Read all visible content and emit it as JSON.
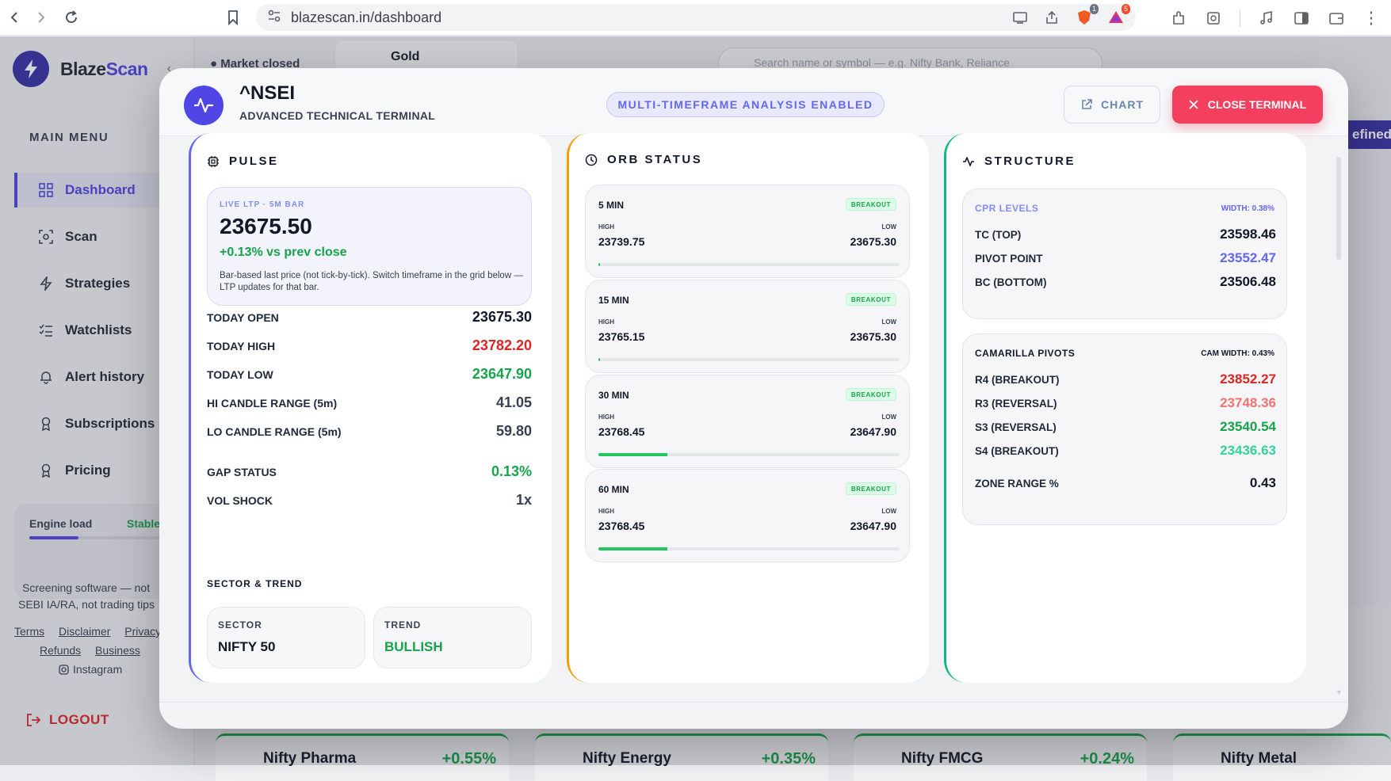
{
  "browser": {
    "url": "blazescan.in/dashboard",
    "ext_badge_1": "1",
    "ext_badge_2": "5"
  },
  "background": {
    "brand_left": "Blaze",
    "brand_right": "Scan",
    "market_status": "● Market closed",
    "gold_label": "Gold",
    "search_placeholder": "Search name or symbol — e.g. Nifty Bank, Reliance",
    "defined_label": "efined",
    "menu_heading": "MAIN MENU",
    "menu_items": [
      "Dashboard",
      "Scan",
      "Strategies",
      "Watchlists",
      "Alert history",
      "Subscriptions",
      "Pricing"
    ],
    "engine_load_label": "Engine load",
    "engine_status": "Stable",
    "engine_load_pct": 31,
    "disclaimer_line1": "Screening software — not",
    "disclaimer_line2": "SEBI IA/RA, not trading tips",
    "footer_links": [
      "Terms",
      "Disclaimer",
      "Privacy",
      "Refunds",
      "Business"
    ],
    "instagram": "Instagram",
    "logout": "LOGOUT",
    "sector_cards": [
      {
        "name": "Nifty Pharma",
        "change": "+0.55%"
      },
      {
        "name": "Nifty Energy",
        "change": "+0.35%"
      },
      {
        "name": "Nifty FMCG",
        "change": "+0.24%"
      },
      {
        "name": "Nifty Metal",
        "change": ""
      }
    ]
  },
  "modal": {
    "symbol": "^NSEI",
    "subtitle": "ADVANCED TECHNICAL TERMINAL",
    "mtf_badge": "MULTI-TIMEFRAME ANALYSIS ENABLED",
    "chart_button": "CHART",
    "close_button": "CLOSE TERMINAL"
  },
  "pulse": {
    "title": "PULSE",
    "ltp_label": "LIVE LTP · 5M BAR",
    "ltp_value": "23675.50",
    "ltp_change": "+0.13% vs prev close",
    "ltp_note": "Bar-based last price (not tick-by-tick). Switch timeframe in the grid below — LTP updates for that bar.",
    "stats": [
      {
        "label": "TODAY OPEN",
        "value": "23675.30"
      },
      {
        "label": "TODAY HIGH",
        "value": "23782.20"
      },
      {
        "label": "TODAY LOW",
        "value": "23647.90"
      },
      {
        "label": "HI CANDLE RANGE (5m)",
        "value": "41.05"
      },
      {
        "label": "LO CANDLE RANGE (5m)",
        "value": "59.80"
      },
      {
        "label": "GAP STATUS",
        "value": "0.13%"
      },
      {
        "label": "VOL SHOCK",
        "value": "1x"
      }
    ],
    "sector_trend_heading": "SECTOR & TREND",
    "sector_label": "SECTOR",
    "sector_value": "NIFTY 50",
    "trend_label": "TREND",
    "trend_value": "BULLISH"
  },
  "orb": {
    "title": "ORB STATUS",
    "high_label": "HIGH",
    "low_label": "LOW",
    "rows": [
      {
        "timeframe": "5 MIN",
        "status": "BREAKOUT",
        "high": "23739.75",
        "low": "23675.30",
        "progress": 0.005
      },
      {
        "timeframe": "15 MIN",
        "status": "BREAKOUT",
        "high": "23765.15",
        "low": "23675.30",
        "progress": 0.003
      },
      {
        "timeframe": "30 MIN",
        "status": "BREAKOUT",
        "high": "23768.45",
        "low": "23647.90",
        "progress": 0.23
      },
      {
        "timeframe": "60 MIN",
        "status": "BREAKOUT",
        "high": "23768.45",
        "low": "23647.90",
        "progress": 0.23
      }
    ]
  },
  "structure": {
    "title": "STRUCTURE",
    "cpr_heading": "CPR LEVELS",
    "cpr_width": "WIDTH: 0.38%",
    "cpr_rows": [
      {
        "label": "TC (TOP)",
        "value": "23598.46"
      },
      {
        "label": "PIVOT POINT",
        "value": "23552.47"
      },
      {
        "label": "BC (BOTTOM)",
        "value": "23506.48"
      }
    ],
    "cam_heading": "CAMARILLA PIVOTS",
    "cam_width": "CAM WIDTH: 0.43%",
    "cam_rows": [
      {
        "label": "R4 (BREAKOUT)",
        "value": "23852.27"
      },
      {
        "label": "R3 (REVERSAL)",
        "value": "23748.36"
      },
      {
        "label": "S3 (REVERSAL)",
        "value": "23540.54"
      },
      {
        "label": "S4 (BREAKOUT)",
        "value": "23436.63"
      }
    ],
    "zone_label": "ZONE RANGE %",
    "zone_value": "0.43"
  },
  "colors": {
    "accent": "#4f46e5",
    "danger": "#f43f5e",
    "positive": "#16a34a",
    "negative": "#dc2626",
    "orb_border": "#f59e0b",
    "structure_border": "#10b981"
  }
}
